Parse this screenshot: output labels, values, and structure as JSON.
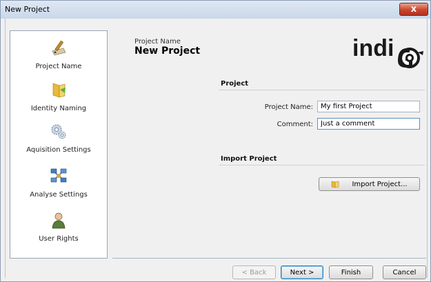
{
  "window": {
    "title": "New Project",
    "close_glyph": "x"
  },
  "nav": {
    "items": [
      {
        "label": "Project Name",
        "icon": "pen-paper-icon"
      },
      {
        "label": "Identity Naming",
        "icon": "folder-icon"
      },
      {
        "label": "Aquisition Settings",
        "icon": "gears-icon"
      },
      {
        "label": "Analyse Settings",
        "icon": "network-icon"
      },
      {
        "label": "User Rights",
        "icon": "user-icon"
      }
    ]
  },
  "header": {
    "small": "Project Name",
    "big": "New Project"
  },
  "logo": {
    "text": "indi"
  },
  "project_section": {
    "title": "Project",
    "name_label": "Project Name:",
    "name_value": "My first Project",
    "comment_label": "Comment:",
    "comment_value": "Just a comment"
  },
  "import_section": {
    "title": "Import Project",
    "button_label": "Import Project..."
  },
  "footer": {
    "back": "< Back",
    "next": "Next >",
    "finish": "Finish",
    "cancel": "Cancel"
  },
  "colors": {
    "titlebar": "#c9d8ea",
    "close": "#c9462e",
    "accent": "#3c7fb1"
  }
}
